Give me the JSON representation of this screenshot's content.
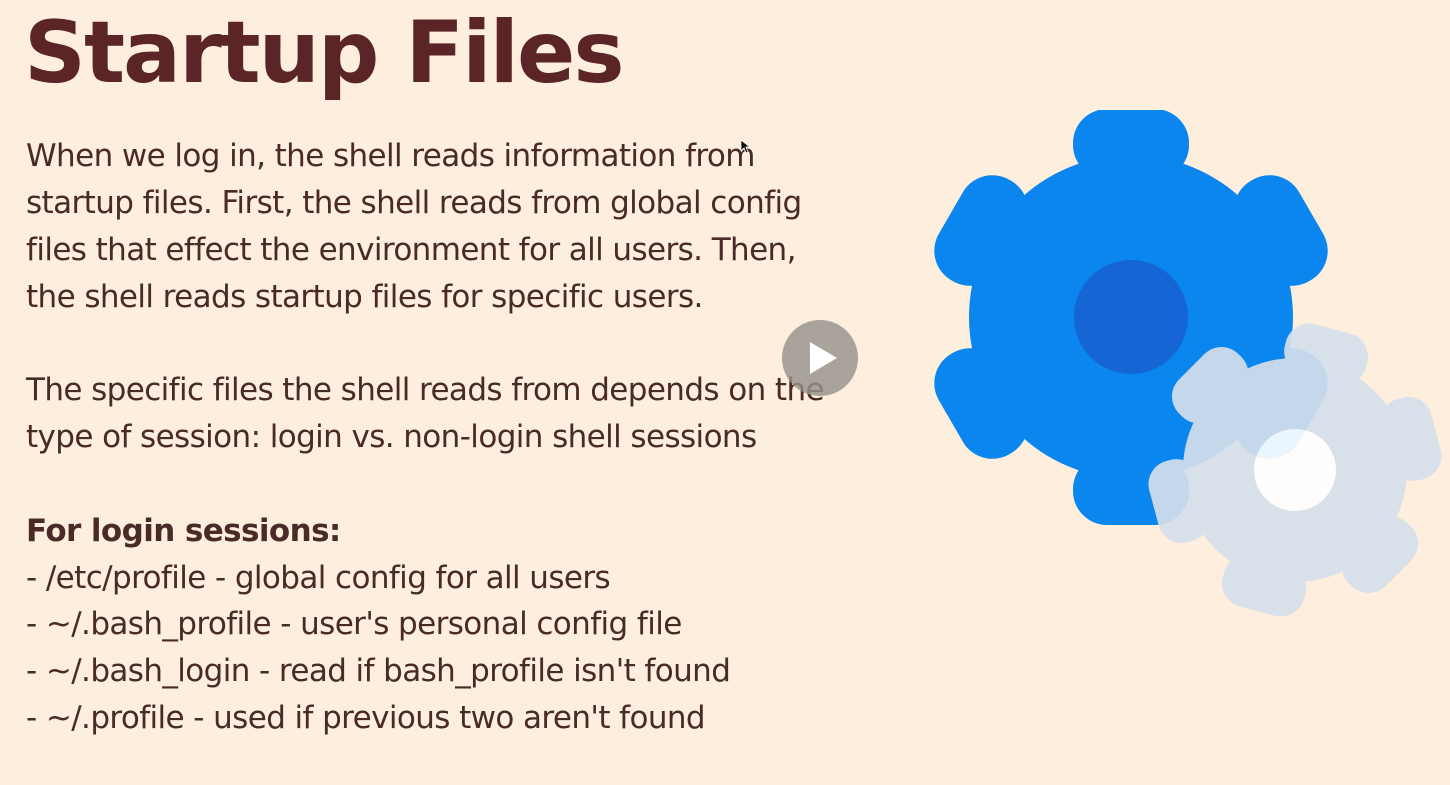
{
  "slide": {
    "title": "Startup Files",
    "paragraph1": {
      "line1": "When we log in, the shell reads information from",
      "line2": "startup files.  First, the shell reads from global config",
      "line3": "files that effect the environment for all users.  Then,",
      "line4": "the shell reads startup files for specific users."
    },
    "paragraph2": {
      "line1": "The specific files the shell reads from depends on the",
      "line2": "type of session: login  vs. non-login shell sessions"
    },
    "login_section": {
      "heading": "For login sessions:",
      "items": [
        "- /etc/profile - global config for all users",
        "- ~/.bash_profile - user's personal config file",
        "- ~/.bash_login - read if bash_profile isn't found",
        "- ~/.profile - used if previous two aren't found"
      ]
    }
  },
  "icons": {
    "gears": "gears-icon",
    "play": "play-icon",
    "cursor": "mouse-cursor-icon"
  },
  "colors": {
    "background": "#fdeedd",
    "title": "#5b2528",
    "text": "#4a2a26",
    "gear_blue": "#0a86ee",
    "gear_blue_hub": "#1565d4",
    "gear_light": "#d5dfeb",
    "gear_light_hub": "#ffffff"
  }
}
